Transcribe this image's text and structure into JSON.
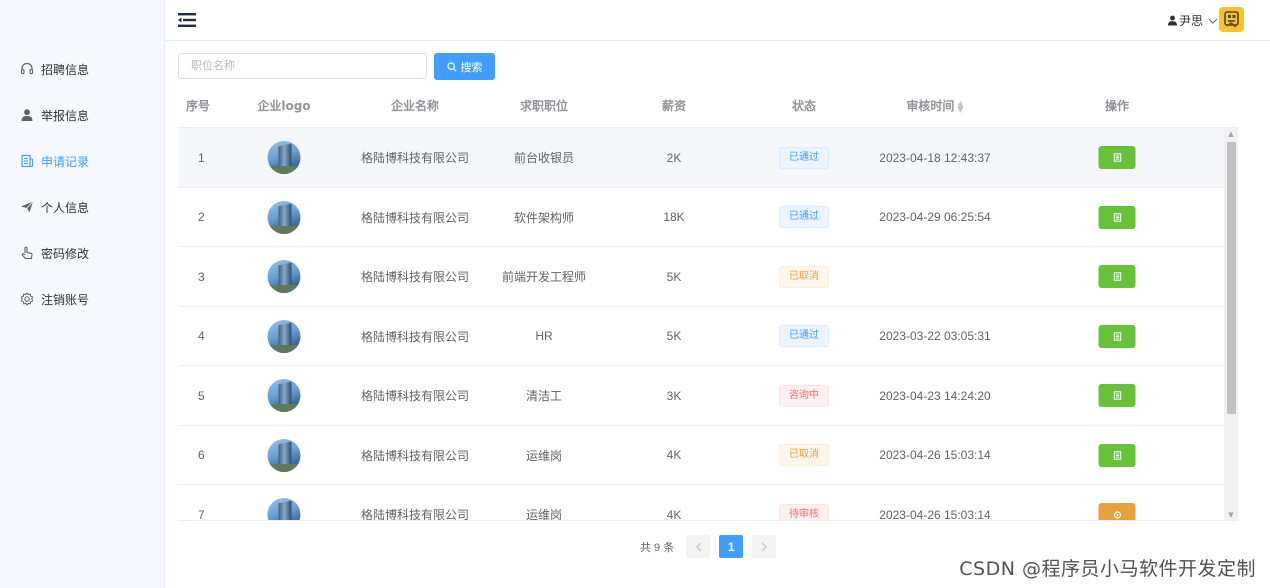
{
  "sidebar": {
    "items": [
      {
        "label": "招聘信息",
        "icon": "headset-icon",
        "active": false
      },
      {
        "label": "举报信息",
        "icon": "user-icon",
        "active": false
      },
      {
        "label": "申请记录",
        "icon": "document-icon",
        "active": true
      },
      {
        "label": "个人信息",
        "icon": "send-icon",
        "active": false
      },
      {
        "label": "密码修改",
        "icon": "hand-pointer-icon",
        "active": false
      },
      {
        "label": "注销账号",
        "icon": "gear-icon",
        "active": false
      }
    ]
  },
  "header": {
    "username": "尹思",
    "menu_icon": "hamburger-icon",
    "avatar_icon": "user-avatar-icon"
  },
  "search": {
    "placeholder": "职位名称",
    "value": "",
    "button_label": "搜索"
  },
  "table": {
    "columns": [
      "序号",
      "企业logo",
      "企业名称",
      "求职职位",
      "薪资",
      "状态",
      "审核时间",
      "操作"
    ],
    "rows": [
      {
        "index": "1",
        "company": "格陆博科技有限公司",
        "position": "前台收银员",
        "salary": "2K",
        "status": "已通过",
        "status_type": "ok",
        "time": "2023-04-18 12:43:37",
        "op": "green"
      },
      {
        "index": "2",
        "company": "格陆博科技有限公司",
        "position": "软件架构师",
        "salary": "18K",
        "status": "已通过",
        "status_type": "ok",
        "time": "2023-04-29 06:25:54",
        "op": "green"
      },
      {
        "index": "3",
        "company": "格陆博科技有限公司",
        "position": "前端开发工程师",
        "salary": "5K",
        "status": "已取消",
        "status_type": "cancel",
        "time": "",
        "op": "green"
      },
      {
        "index": "4",
        "company": "格陆博科技有限公司",
        "position": "HR",
        "salary": "5K",
        "status": "已通过",
        "status_type": "ok",
        "time": "2023-03-22 03:05:31",
        "op": "green"
      },
      {
        "index": "5",
        "company": "格陆博科技有限公司",
        "position": "清洁工",
        "salary": "3K",
        "status": "咨询中",
        "status_type": "consult",
        "time": "2023-04-23 14:24:20",
        "op": "green"
      },
      {
        "index": "6",
        "company": "格陆博科技有限公司",
        "position": "运维岗",
        "salary": "4K",
        "status": "已取消",
        "status_type": "cancel",
        "time": "2023-04-26 15:03:14",
        "op": "green"
      },
      {
        "index": "7",
        "company": "格陆博科技有限公司",
        "position": "运维岗",
        "salary": "4K",
        "status": "待审核",
        "status_type": "pending",
        "time": "2023-04-26 15:03:14",
        "op": "orange"
      }
    ]
  },
  "pagination": {
    "total_text": "共 9 条",
    "current_page": "1",
    "prev_icon": "chevron-left-icon",
    "next_icon": "chevron-right-icon"
  },
  "watermark": "CSDN @程序员小马软件开发定制",
  "colors": {
    "primary": "#409eff",
    "success": "#67c23a",
    "warning": "#e6a23c",
    "danger": "#f56c6c"
  }
}
